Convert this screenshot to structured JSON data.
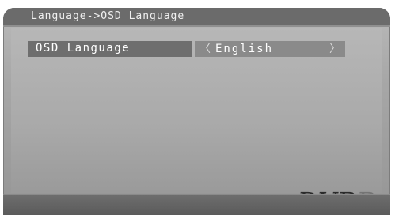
{
  "header": {
    "breadcrumb": "Language->OSD Language"
  },
  "setting": {
    "label": "OSD Language",
    "value": "English",
    "prev_glyph": "〈",
    "next_glyph": "〉"
  },
  "logo": {
    "main": "DVB",
    "trail": "B"
  },
  "colors": {
    "header_bar": "#6b6b6b",
    "panel": "#a9a9a9",
    "selected_label_bg": "#6e6e6e",
    "value_bg": "#8a8a8a",
    "bottom_band": "#5a5a5a"
  }
}
